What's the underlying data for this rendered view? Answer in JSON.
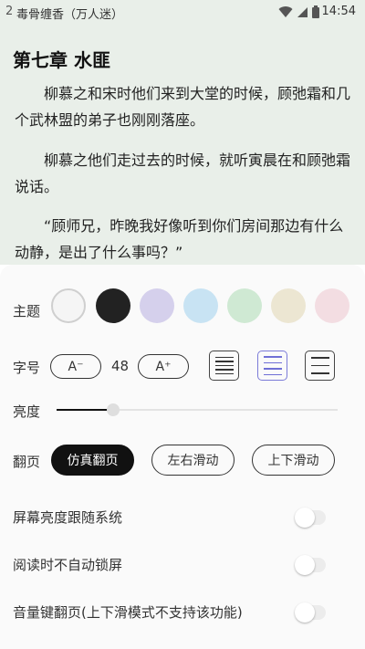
{
  "status_bar": {
    "time_left": "2",
    "book_title": "毒骨缠香（万人迷）",
    "time": "14:54",
    "icons": [
      "wifi-icon",
      "signal-icon",
      "battery-icon"
    ]
  },
  "reader": {
    "chapter_title": "第七章 水匪",
    "paragraphs": [
      "柳慕之和宋时他们来到大堂的时候，顾弛霜和几个武林盟的弟子也刚刚落座。",
      "柳慕之他们走过去的时候，就听寅晨在和顾弛霜说话。",
      "“顾师兄，昨晚我好像听到你们房间那边有什么动静，是出了什么事吗？”"
    ],
    "background": "#e9efe9"
  },
  "settings": {
    "theme": {
      "label": "主题",
      "swatches": [
        "#f5f5f5",
        "#222222",
        "#d5d0ec",
        "#c8e3f3",
        "#cfe9d3",
        "#ece6d2",
        "#f3dde2"
      ],
      "selected_index": 0
    },
    "font_size": {
      "label": "字号",
      "decrease_label": "A⁻",
      "increase_label": "A⁺",
      "value": "48",
      "spacing_options": [
        "tight",
        "medium",
        "loose"
      ],
      "selected_spacing": 1
    },
    "brightness": {
      "label": "亮度",
      "level": 0.2
    },
    "page_turn": {
      "label": "翻页",
      "options": [
        "仿真翻页",
        "左右滑动",
        "上下滑动"
      ],
      "selected_index": 0
    },
    "toggles": [
      {
        "label": "屏幕亮度跟随系统",
        "on": false
      },
      {
        "label": "阅读时不自动锁屏",
        "on": false
      },
      {
        "label": "音量键翻页(上下滑模式不支持该功能)",
        "on": false
      }
    ]
  }
}
